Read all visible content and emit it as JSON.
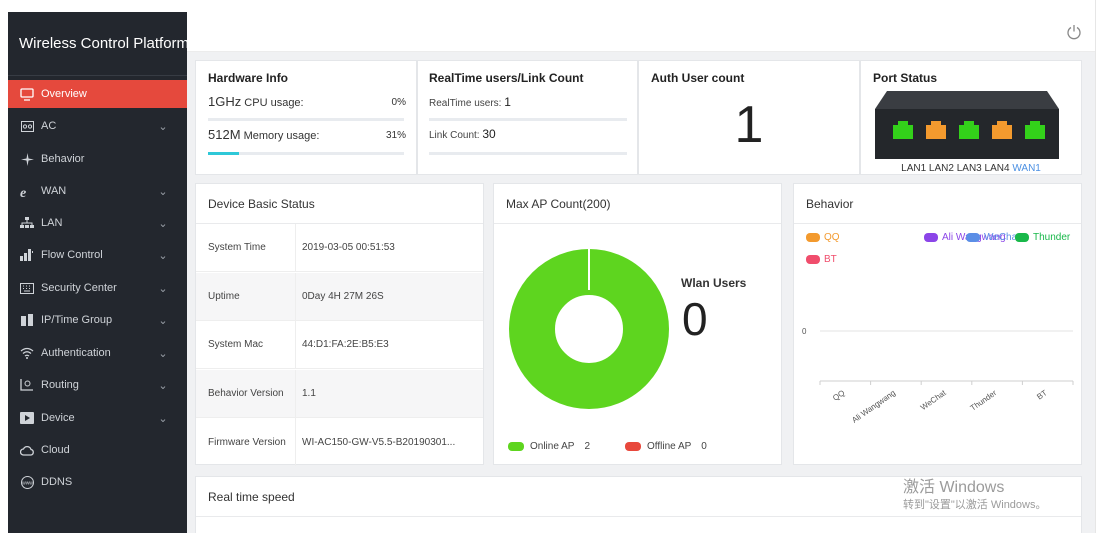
{
  "app": {
    "title": "Wireless Control Platform"
  },
  "sidebar": {
    "items": [
      {
        "label": "Overview",
        "icon": "monitor-icon",
        "active": true,
        "chevron": false
      },
      {
        "label": "AC",
        "icon": "ac-icon",
        "chevron": true
      },
      {
        "label": "Behavior",
        "icon": "sparkle-icon",
        "chevron": false
      },
      {
        "label": "WAN",
        "icon": "internet-icon",
        "chevron": true
      },
      {
        "label": "LAN",
        "icon": "network-icon",
        "chevron": true
      },
      {
        "label": "Flow Control",
        "icon": "bars-icon",
        "chevron": true
      },
      {
        "label": "Security Center",
        "icon": "keyboard-icon",
        "chevron": true
      },
      {
        "label": "IP/Time Group",
        "icon": "group-icon",
        "chevron": true
      },
      {
        "label": "Authentication",
        "icon": "wifi-icon",
        "chevron": true
      },
      {
        "label": "Routing",
        "icon": "routing-icon",
        "chevron": true
      },
      {
        "label": "Device",
        "icon": "device-icon",
        "chevron": true
      },
      {
        "label": "Cloud",
        "icon": "cloud-icon",
        "chevron": false
      },
      {
        "label": "DDNS",
        "icon": "ddns-icon",
        "chevron": false
      }
    ],
    "chevron_glyph": "⌄"
  },
  "hardware": {
    "title": "Hardware Info",
    "cpu_value": "1GHz",
    "cpu_label": "CPU usage:",
    "cpu_pct": "0%",
    "cpu_fraction": 0,
    "mem_value": "512M",
    "mem_label": "Memory usage:",
    "mem_pct": "31%",
    "mem_fraction": 0.16
  },
  "realtime": {
    "title": "RealTime users/Link Count",
    "users_label": "RealTime users:",
    "users_value": "1",
    "link_label": "Link Count:",
    "link_value": "30"
  },
  "auth": {
    "title": "Auth User count",
    "value": "1"
  },
  "port": {
    "title": "Port Status",
    "lan_labels": "LAN1 LAN2 LAN3 LAN4",
    "wan_label": "WAN1",
    "colors": {
      "lan": "#33d11a",
      "wan": "#f39a2e"
    }
  },
  "device_status": {
    "title": "Device Basic Status",
    "rows": [
      {
        "key": "System Time",
        "value": "2019-03-05 00:51:53"
      },
      {
        "key": "Uptime",
        "value": "0Day 4H 27M 26S"
      },
      {
        "key": "System Mac",
        "value": "44:D1:FA:2E:B5:E3"
      },
      {
        "key": "Behavior Version",
        "value": "1.1"
      },
      {
        "key": "Firmware Version",
        "value": "WI-AC150-GW-V5.5-B20190301..."
      }
    ]
  },
  "ap": {
    "title": "Max AP Count(200)",
    "wlan_label": "Wlan Users",
    "wlan_value": "0",
    "online_label": "Online AP",
    "online_value": "2",
    "offline_label": "Offline AP",
    "offline_value": "0",
    "colors": {
      "online": "#5ed51f",
      "offline": "#e8483c"
    }
  },
  "behavior": {
    "title": "Behavior",
    "legend": [
      {
        "name": "QQ",
        "color": "#f39a2e"
      },
      {
        "name": "Ali Wangwang",
        "color": "#8b45e8"
      },
      {
        "name": "WeChat",
        "color": "#5b8ee6"
      },
      {
        "name": "Thunder",
        "color": "#19b84a"
      },
      {
        "name": "BT",
        "color": "#f04d6c"
      }
    ],
    "y_tick": "0",
    "categories": [
      "QQ",
      "Ali Wangwang",
      "WeChat",
      "Thunder",
      "BT"
    ]
  },
  "speed": {
    "title": "Real time speed"
  },
  "watermark": {
    "line1": "激活 Windows",
    "line2": "转到\"设置\"以激活 Windows。"
  }
}
